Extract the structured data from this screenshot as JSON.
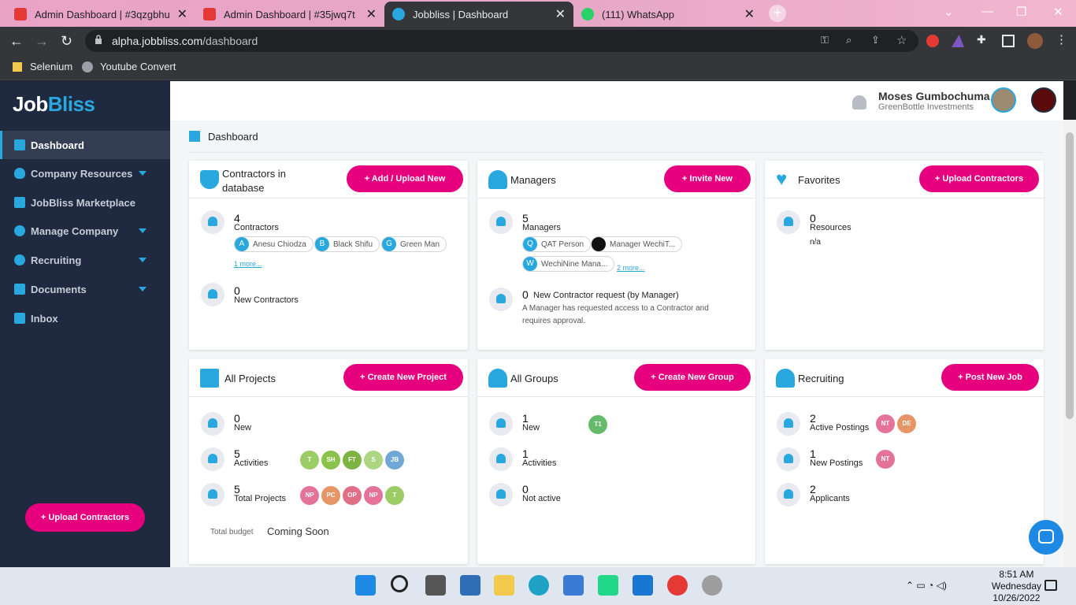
{
  "browser": {
    "tabs": [
      {
        "title": "Admin Dashboard | #3qzgbhu"
      },
      {
        "title": "Admin Dashboard | #35jwq7t"
      },
      {
        "title": "Jobbliss | Dashboard"
      },
      {
        "title": "(111) WhatsApp"
      }
    ],
    "url_host": "alpha.jobbliss.com",
    "url_path": "/dashboard",
    "bookmarks": [
      "Selenium",
      "Youtube Convert"
    ]
  },
  "app": {
    "logo_a": "Job",
    "logo_b": "Bliss",
    "user": {
      "name": "Moses Gumbochuma",
      "company": "GreenBottle Investments"
    },
    "breadcrumb": "Dashboard",
    "sidebar": [
      {
        "label": "Dashboard"
      },
      {
        "label": "Company Resources"
      },
      {
        "label": "JobBliss Marketplace"
      },
      {
        "label": "Manage Company"
      },
      {
        "label": "Recruiting"
      },
      {
        "label": "Documents"
      },
      {
        "label": "Inbox"
      }
    ],
    "upload_button": "+ Upload Contractors"
  },
  "cards": {
    "contractors": {
      "title": "Contractors in database",
      "button": "+ Add / Upload New",
      "count": "4",
      "count_label": "Contractors",
      "chips": [
        {
          "initial": "A",
          "name": "Anesu Chiodza"
        },
        {
          "initial": "B",
          "name": "Black Shifu"
        },
        {
          "initial": "G",
          "name": "Green Man"
        }
      ],
      "more": "1 more...",
      "new_count": "0",
      "new_label": "New Contractors"
    },
    "managers": {
      "title": "Managers",
      "button": "+ Invite New",
      "count": "5",
      "count_label": "Managers",
      "chips": [
        {
          "initial": "Q",
          "name": "QAT Person"
        },
        {
          "initial": "",
          "name": "Manager WechiT..."
        },
        {
          "initial": "W",
          "name": "WechiNine Mana..."
        }
      ],
      "more": "2 more...",
      "req_count": "0",
      "req_label": "New Contractor request (by Manager)",
      "req_desc": "A Manager has requested access to a Contractor and requires approval."
    },
    "favorites": {
      "title": "Favorites",
      "button": "+ Upload Contractors",
      "count": "0",
      "count_label": "Resources",
      "na": "n/a"
    },
    "projects": {
      "title": "All Projects",
      "button": "+ Create New Project",
      "rows": [
        {
          "count": "0",
          "label": "New",
          "dots": []
        },
        {
          "count": "5",
          "label": "Activities",
          "dots": [
            "T",
            "SH",
            "FT",
            "S",
            "JB"
          ]
        },
        {
          "count": "5",
          "label": "Total Projects",
          "dots": [
            "NP",
            "PC",
            "OP",
            "NP",
            "T"
          ]
        }
      ],
      "budget_label": "Total budget",
      "budget_value": "Coming Soon"
    },
    "groups": {
      "title": "All Groups",
      "button": "+ Create New Group",
      "rows": [
        {
          "count": "1",
          "label": "New",
          "dots": [
            "T1"
          ]
        },
        {
          "count": "1",
          "label": "Activities",
          "dots": []
        },
        {
          "count": "0",
          "label": "Not active",
          "dots": []
        }
      ]
    },
    "recruiting": {
      "title": "Recruiting",
      "button": "+ Post New Job",
      "rows": [
        {
          "count": "2",
          "label": "Active Postings",
          "dots": [
            "NT",
            "DE"
          ]
        },
        {
          "count": "1",
          "label": "New Postings",
          "dots": [
            "NT"
          ]
        },
        {
          "count": "2",
          "label": "Applicants",
          "dots": []
        }
      ]
    }
  },
  "system": {
    "time": "8:51 AM",
    "day": "Wednesday",
    "date": "10/26/2022"
  },
  "colors": {
    "accent": "#e6007e",
    "brand": "#29a8e0",
    "sidebar": "#1f2a40"
  }
}
